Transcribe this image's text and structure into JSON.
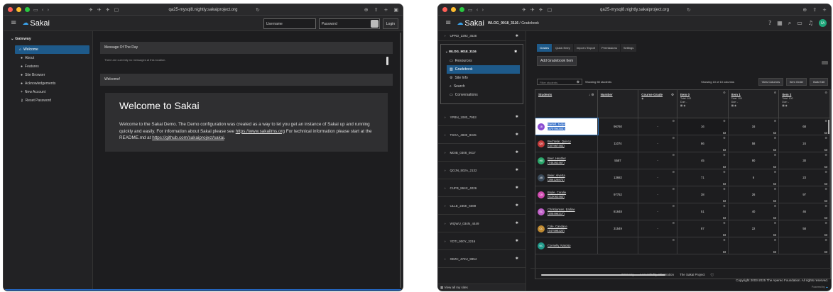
{
  "browser": {
    "url": "qa25-mysql8.nightly.sakaiproject.org",
    "traffic_colors": [
      "#ff5f57",
      "#febc2e",
      "#28c840"
    ]
  },
  "w1": {
    "logo": "Sakai",
    "username_placeholder": "Username",
    "password_placeholder": "Password",
    "login_label": "Login",
    "gateway_label": "Gateway",
    "nav": [
      {
        "icon": "home-icon",
        "glyph": "⌂",
        "label": "Welcome",
        "active": true
      },
      {
        "icon": "info-icon",
        "glyph": "●",
        "label": "About"
      },
      {
        "icon": "info-icon",
        "glyph": "●",
        "label": "Features"
      },
      {
        "icon": "globe-icon",
        "glyph": "●",
        "label": "Site Browser"
      },
      {
        "icon": "info-icon",
        "glyph": "●",
        "label": "Acknowledgements"
      },
      {
        "icon": "add-user-icon",
        "glyph": "+",
        "label": "New Account"
      },
      {
        "icon": "key-icon",
        "glyph": "⚷",
        "label": "Reset Password"
      }
    ],
    "motd_title": "Message Of The Day",
    "motd_text": "There are currently no messages at this location.",
    "welcome_panel": "Welcome!",
    "welcome_heading": "Welcome to Sakai",
    "welcome_p1": "Welcome to the Sakai Demo. The Demo configuration was created as a way to let you get an instance of Sakai up and running quickly and easily. For information about Sakai please see ",
    "welcome_link1": "https://www.sakailms.org",
    "welcome_p2": " For technical information please start at the README.md at ",
    "welcome_link2": "https://github.com/sakaiproject/sakai",
    "welcome_p3": "."
  },
  "w2": {
    "logo": "Sakai",
    "site_title": "WLOG_9018_3116",
    "crumb_sep": "/",
    "crumb_page": "Gradebook",
    "avatar_initials": "SA",
    "sites_before": [
      {
        "name": "UPRD_2292_3538"
      }
    ],
    "open_site": "WLOG_9018_3116",
    "tools": [
      {
        "icon": "folder-icon",
        "glyph": "▭",
        "label": "Resources"
      },
      {
        "icon": "gradebook-icon",
        "glyph": "▥",
        "label": "Gradebook",
        "active": true
      },
      {
        "icon": "settings-icon",
        "glyph": "⚙",
        "label": "Site Info"
      },
      {
        "icon": "search-icon",
        "glyph": "⌕",
        "label": "Search"
      },
      {
        "icon": "chat-icon",
        "glyph": "▭",
        "label": "Conversations"
      }
    ],
    "sites_after": [
      {
        "name": "YPBN_1080_7953"
      },
      {
        "name": "TSGA_4830_8345"
      },
      {
        "name": "MDIB_0308_0617"
      },
      {
        "name": "QOJN_502A_2132"
      },
      {
        "name": "CUFB_864X_4026"
      },
      {
        "name": "ULLE_235K_6089"
      },
      {
        "name": "WQWU_034N_4449"
      },
      {
        "name": "YDTI_900Y_3216"
      },
      {
        "name": "XEZH_472U_9954"
      }
    ],
    "view_all": "View all my sites",
    "tabs": [
      "Grades",
      "Quick Entry",
      "Import / Export",
      "Permissions",
      "Settings"
    ],
    "add_item": "Add Gradebook Item",
    "filter_placeholder": "Filter students",
    "showing_students": "Showing 50 students",
    "showing_columns": "Showing 10 of 10 columns",
    "view_columns": "View Columns",
    "item_order": "Item Order",
    "bulk_edit": "Bulk Edit",
    "headers": {
      "students": "Students",
      "sort": "↓",
      "number": "Number",
      "course_grade": "Course Grade",
      "items": [
        {
          "name": "Item 0",
          "total": "Total: 100",
          "due": "Due: -"
        },
        {
          "name": "Item 1",
          "total": "Total: 100",
          "due": "Due: -"
        },
        {
          "name": "Item 2",
          "total": "Total: 100",
          "due": "Due: -"
        }
      ]
    },
    "rows": [
      {
        "initials": "JB",
        "color": "#8a4bd1",
        "name": "Bartell, Jadyn",
        "id": "(370794303)",
        "number": "96760",
        "cg": "-",
        "g": [
          "16",
          "16",
          "68"
        ],
        "selected": true
      },
      {
        "initials": "QB",
        "color": "#c53a3a",
        "name": "Bechtelar, Quincy",
        "id": "(007967483)",
        "number": "11074",
        "cg": "-",
        "g": [
          "86",
          "58",
          "24"
        ]
      },
      {
        "initials": "HB",
        "color": "#2aa66a",
        "name": "Beer, Heather",
        "id": "(745262467)",
        "number": "5587",
        "cg": "-",
        "g": [
          "45",
          "90",
          "30"
        ]
      },
      {
        "initials": "AB",
        "color": "#3a4a5a",
        "name": "Beier, Alverta",
        "id": "(266126873)",
        "number": "13682",
        "cg": "-",
        "g": [
          "71",
          "6",
          "23"
        ]
      },
      {
        "initials": "CB",
        "color": "#d04ab0",
        "name": "Boyle, Coralie",
        "id": "(510063460)",
        "number": "97752",
        "cg": "-",
        "g": [
          "38",
          "26",
          "97"
        ]
      },
      {
        "initials": "EC",
        "color": "#c060c8",
        "name": "Christiansen, Earline",
        "id": "(205498217)",
        "number": "81648",
        "cg": "-",
        "g": [
          "51",
          "40",
          "46"
        ]
      },
      {
        "initials": "CC",
        "color": "#c08a30",
        "name": "Cole, Candace",
        "id": "(447598220)",
        "number": "31549",
        "cg": "-",
        "g": [
          "87",
          "22",
          "58"
        ]
      },
      {
        "initials": "NC",
        "color": "#1f9a8a",
        "name": "Connelly, Narciso",
        "id": "",
        "number": "",
        "cg": "",
        "g": [
          "",
          "",
          ""
        ]
      }
    ],
    "footer_links": [
      "Gateway",
      "Accessibility Information",
      "The Sakai Project"
    ],
    "copyright": "Copyright 2003-2025 The Apereo Foundation. All rights reserved.",
    "powered_by": "Powered by"
  }
}
